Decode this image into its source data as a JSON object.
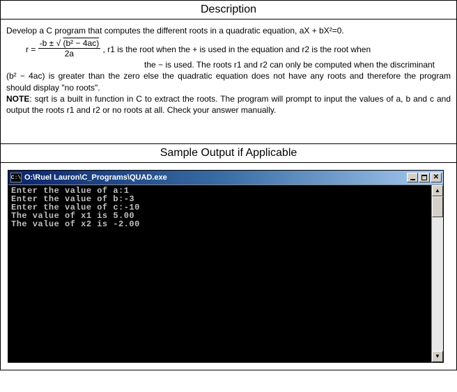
{
  "description": {
    "header": "Description",
    "intro": "Develop a C program that computes the different roots in a quadratic equation, aX + bX²=0.",
    "formula_lhs": "r = ",
    "formula_numer_prefix": "-b ± √ ",
    "formula_numer_sqrt": "(b² − 4ac)",
    "formula_denom": "2a",
    "formula_tail1": " , r1 is the root when the + is used in the equation and r2 is the root when",
    "line2_prefix_spacer": "",
    "line2": "the − is used. The roots r1 and r2 can only be computed when the discriminant",
    "line3": "(b² − 4ac) is greater than the zero else the quadratic equation does not have any roots and therefore the program should display \"no roots\".",
    "note_label": "NOTE",
    "note_text": ": sqrt is a built in function in C to extract the roots. The program will prompt to input the values of a, b and c and output the roots r1 and r2 or no roots at all. Check your answer manually."
  },
  "sample": {
    "header": "Sample Output if Applicable"
  },
  "console": {
    "icon_text": "C:\\",
    "title": "O:\\Ruel Lauron\\C_Programs\\QUAD.exe",
    "lines": [
      "Enter the value of a:1",
      "Enter the value of b:-3",
      "Enter the value of c:-10",
      "The value of x1 is 5.00",
      "The value of x2 is -2.00"
    ],
    "scroll_up": "▲",
    "scroll_down": "▼",
    "close_symbol": "✕"
  }
}
